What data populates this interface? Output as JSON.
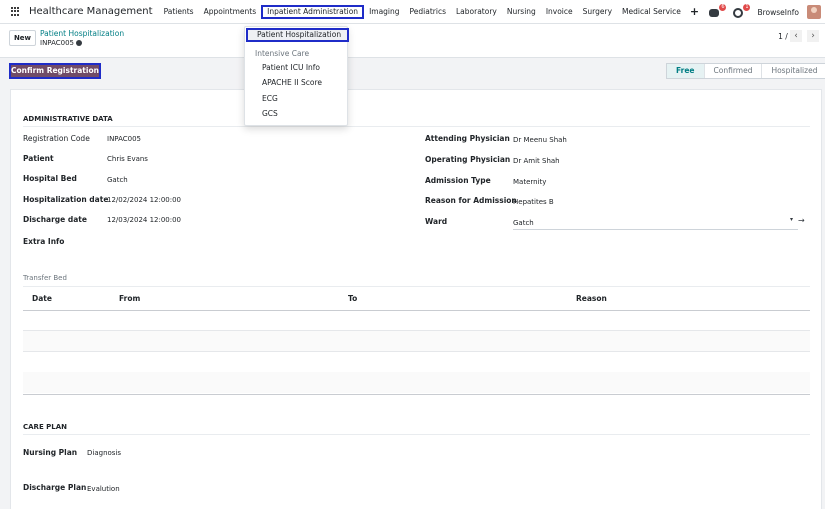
{
  "app": {
    "title": "Healthcare Management"
  },
  "menu": [
    {
      "label": "Patients"
    },
    {
      "label": "Appointments"
    },
    {
      "label": "Inpatient Administration",
      "active": true
    },
    {
      "label": "Imaging"
    },
    {
      "label": "Pediatrics"
    },
    {
      "label": "Laboratory"
    },
    {
      "label": "Nursing"
    },
    {
      "label": "Invoice"
    },
    {
      "label": "Surgery"
    },
    {
      "label": "Medical Service"
    }
  ],
  "menu_plus": "+",
  "nav_right": {
    "chat_badge": "6",
    "activity_badge": "1",
    "company": "BrowseInfo"
  },
  "control": {
    "new_label": "New",
    "breadcrumb": "Patient Hospitalization",
    "record_name": "INPAC005",
    "pager": "1 / 1"
  },
  "actions": {
    "confirm_label": "Confirm Registration"
  },
  "stages": [
    "Free",
    "Confirmed",
    "Hospitalized"
  ],
  "admin": {
    "title": "ADMINISTRATIVE DATA",
    "registration_code_label": "Registration Code",
    "registration_code": "INPAC005",
    "patient_label": "Patient",
    "patient": "Chris Evans",
    "bed_label": "Hospital Bed",
    "bed": "Gatch",
    "hosp_date_label": "Hospitalization date",
    "hosp_date": "12/02/2024 12:00:00",
    "discharge_date_label": "Discharge date",
    "discharge_date": "12/03/2024 12:00:00",
    "extra_info_label": "Extra Info",
    "attending_label": "Attending Physician",
    "attending": "Dr Meenu Shah",
    "operating_label": "Operating Physician",
    "operating": "Dr Amit Shah",
    "admission_type_label": "Admission Type",
    "admission_type": "Maternity",
    "reason_label": "Reason for Admission",
    "reason": "Hepatites B",
    "ward_label": "Ward",
    "ward": "Gatch"
  },
  "transfer": {
    "title": "Transfer Bed",
    "columns": [
      "Date",
      "From",
      "To",
      "Reason"
    ]
  },
  "care_plan": {
    "title": "CARE PLAN",
    "nursing_label": "Nursing Plan",
    "nursing": "Diagnosis",
    "discharge_label": "Discharge Plan",
    "discharge": "Evalution"
  },
  "dropdown": {
    "highlight": "Patient Hospitalization",
    "header": "Intensive Care",
    "items": [
      "Patient ICU Info",
      "APACHE II Score",
      "ECG",
      "GCS"
    ]
  },
  "colors": {
    "primary": "#714b67",
    "accent": "#017e84",
    "highlight_border": "#1f2cc8"
  }
}
